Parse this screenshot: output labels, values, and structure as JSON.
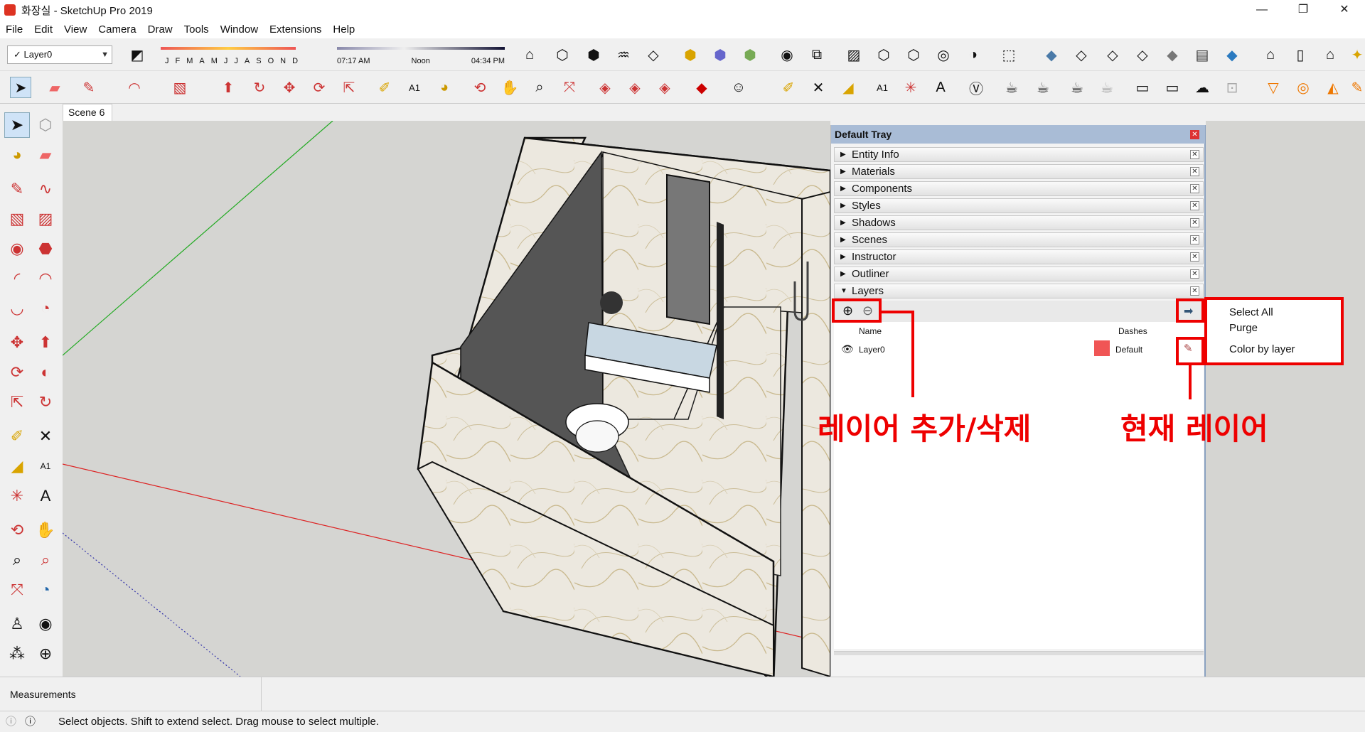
{
  "window": {
    "title": "화장실 - SketchUp Pro 2019",
    "controls": [
      "—",
      "❐",
      "✕"
    ]
  },
  "menu": [
    "File",
    "Edit",
    "View",
    "Camera",
    "Draw",
    "Tools",
    "Window",
    "Extensions",
    "Help"
  ],
  "layer_dropdown": {
    "value": "Layer0"
  },
  "shadows": {
    "months": [
      "J",
      "F",
      "M",
      "A",
      "M",
      "J",
      "J",
      "A",
      "S",
      "O",
      "N",
      "D"
    ],
    "time_start": "07:17 AM",
    "time_mid": "Noon",
    "time_end": "04:34 PM"
  },
  "scenes": {
    "tabs": [
      "Scene 6"
    ]
  },
  "tray": {
    "title": "Default Tray",
    "panels": [
      {
        "label": "Entity Info",
        "expanded": false
      },
      {
        "label": "Materials",
        "expanded": false
      },
      {
        "label": "Components",
        "expanded": false
      },
      {
        "label": "Styles",
        "expanded": false
      },
      {
        "label": "Shadows",
        "expanded": false
      },
      {
        "label": "Scenes",
        "expanded": false
      },
      {
        "label": "Instructor",
        "expanded": false
      },
      {
        "label": "Outliner",
        "expanded": false
      },
      {
        "label": "Layers",
        "expanded": true
      }
    ],
    "layers": {
      "columns": {
        "name": "Name",
        "dashes": "Dashes"
      },
      "rows": [
        {
          "name": "Layer0",
          "color": "#f05555",
          "dashes": "Default",
          "visible": true,
          "current": true
        }
      ]
    }
  },
  "details_menu": {
    "items": [
      "Select All",
      "Purge",
      "Color by layer"
    ]
  },
  "annotations": {
    "add_delete": "레이어 추가/삭제",
    "current_layer": "현재 레이어"
  },
  "measurements": {
    "label": "Measurements"
  },
  "status": {
    "message": "Select objects. Shift to extend select. Drag mouse to select multiple."
  },
  "colors": {
    "annotation": "#ee0000",
    "tray_header": "#a9bcd6",
    "viewport_bg": "#d5d5d2",
    "marble": "#ece8df"
  }
}
